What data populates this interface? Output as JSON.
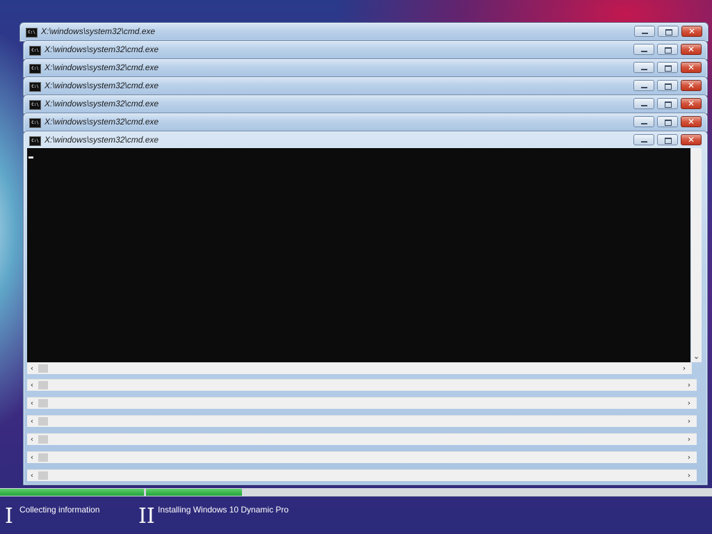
{
  "windows": [
    {
      "title": "X:\\windows\\system32\\cmd.exe"
    },
    {
      "title": "X:\\windows\\system32\\cmd.exe"
    },
    {
      "title": "X:\\windows\\system32\\cmd.exe"
    },
    {
      "title": "X:\\windows\\system32\\cmd.exe"
    },
    {
      "title": "X:\\windows\\system32\\cmd.exe"
    },
    {
      "title": "X:\\windows\\system32\\cmd.exe"
    },
    {
      "title": "X:\\windows\\system32\\cmd.exe"
    }
  ],
  "icons": {
    "window_icon": "cmd-icon",
    "minimize": "minimize-icon",
    "maximize": "maximize-icon",
    "close": "close-icon",
    "scroll_left": "‹",
    "scroll_right": "›",
    "scroll_down": "⌄"
  },
  "setup": {
    "steps": [
      {
        "number": "I",
        "label": "Collecting information"
      },
      {
        "number": "II",
        "label": "Installing Windows 10 Dynamic Pro"
      }
    ],
    "progress": {
      "step1_fraction": 1.0,
      "step2_fraction": 0.17
    },
    "colors": {
      "progress_fill": "#24a23c",
      "progress_track": "#d6dadd"
    }
  }
}
